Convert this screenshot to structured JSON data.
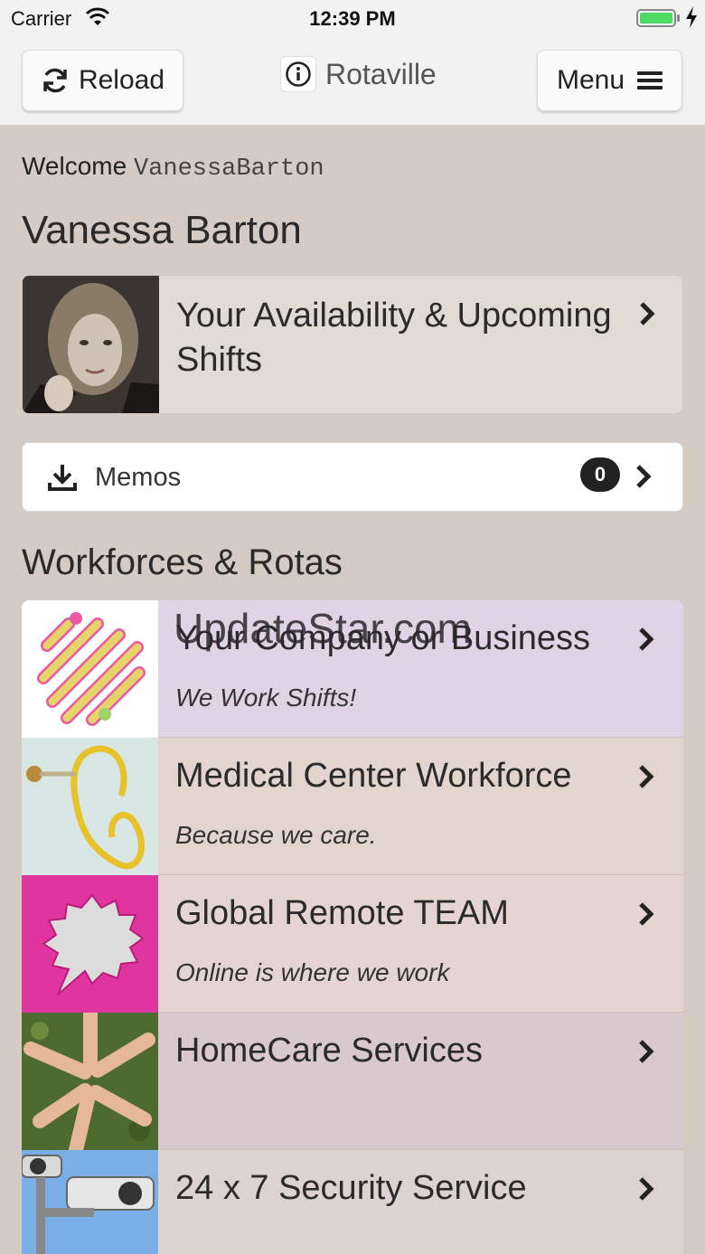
{
  "status_bar": {
    "carrier": "Carrier",
    "time": "12:39 PM"
  },
  "nav": {
    "reload_label": "Reload",
    "title": "Rotaville",
    "menu_label": "Menu"
  },
  "welcome": {
    "prefix": "Welcome",
    "username": "VanessaBarton"
  },
  "user": {
    "full_name": "Vanessa Barton"
  },
  "availability": {
    "title": "Your Availability & Upcoming Shifts"
  },
  "memos": {
    "label": "Memos",
    "count": "0"
  },
  "section": {
    "title": "Workforces & Rotas"
  },
  "workforces": [
    {
      "title": "Your Company or Business",
      "subtitle": "We Work Shifts!",
      "bg": "#e0d3e6"
    },
    {
      "title": "Medical Center Workforce",
      "subtitle": "Because we care.",
      "bg": "#e3d5ce"
    },
    {
      "title": "Global Remote TEAM",
      "subtitle": "Online is where we work",
      "bg": "#e6d4d2"
    },
    {
      "title": "HomeCare Services",
      "subtitle": "",
      "bg": "#d9c9cf"
    },
    {
      "title": "24 x 7 Security Service",
      "subtitle": "",
      "bg": "#dcd3d1"
    }
  ],
  "watermark": "UpdateStar.com",
  "icons": {
    "reload": "reload-icon",
    "info": "info-icon",
    "menu": "hamburger-icon",
    "download": "download-icon",
    "chevron": "chevron-right-icon"
  }
}
